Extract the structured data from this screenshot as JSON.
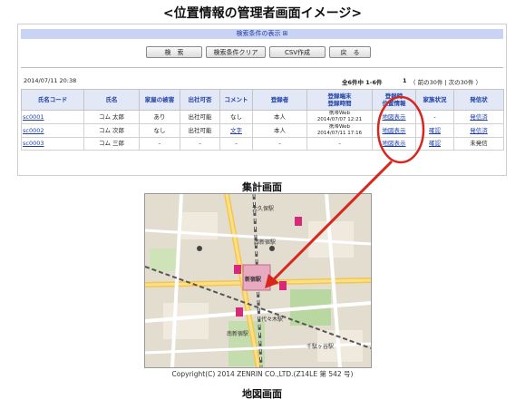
{
  "page_title": "<位置情報の管理者画面イメージ>",
  "search_toggle": "検索条件の表示 ⊞",
  "buttons": [
    "検　索",
    "検索条件クリア",
    "CSV作成",
    "戻　る"
  ],
  "timestamp": "2014/07/11 20:38",
  "pager": {
    "count": "全6件中 1-6件",
    "page": "1",
    "nav": "（ 前の30件 | 次の30件 ）"
  },
  "table": {
    "headers": [
      "氏名コード",
      "氏名",
      "家屋の被害",
      "出社可否",
      "コメント",
      "登録者",
      "登録端末\n登録時間",
      "登録時\n位置情報",
      "家族状況",
      "発信状"
    ],
    "rows": [
      [
        "sc0001",
        "コム 太郎",
        "あり",
        "出社可能",
        "なし",
        "本人",
        "携帯Web\n2014/07/07 12:21",
        "地図表示",
        "-",
        "発信済"
      ],
      [
        "sc0002",
        "コム 次郎",
        "なし",
        "出社可能",
        "文字",
        "本人",
        "携帯Web\n2014/07/11 17:16",
        "地図表示",
        "確認",
        "発信済"
      ],
      [
        "sc0003",
        "コム 三郎",
        "-",
        "-",
        "-",
        "-",
        "-",
        "地図表示",
        "確認",
        "未発信"
      ]
    ]
  },
  "caption_summary": "集計画面",
  "caption_map": "地図画面",
  "copyright": "Copyright(C) 2014 ZENRIN CO.,LTD.(Z14LE 第 542 号)",
  "map_labels": {
    "okubo": "大久保駅",
    "nishishinjuku": "西新宿駅",
    "shinjuku": "新宿駅",
    "yoyogi": "代々木駅",
    "minamishinjuku": "南新宿駅",
    "sendagaya": "千駄ヶ谷駅"
  },
  "colors": {
    "arrow": "#d7261e",
    "highlight_circle": "#d7261e",
    "link": "#1e3fa8",
    "header_bg": "#e2e8f5",
    "search_bar": "#c9d3f4"
  }
}
